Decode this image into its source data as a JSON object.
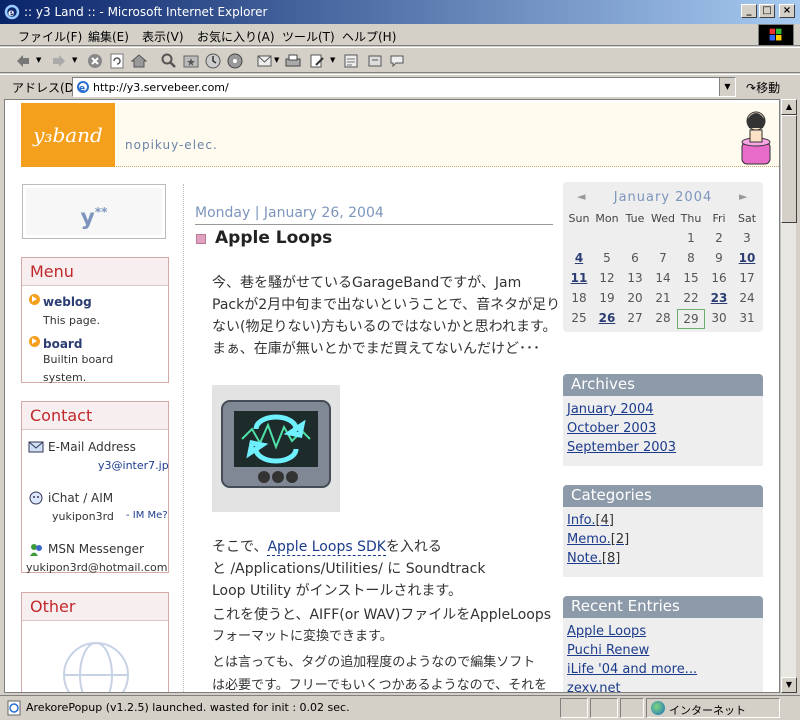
{
  "window": {
    "title": ":: y3 Land :: - Microsoft Internet Explorer",
    "controls": [
      "_",
      "□",
      "×"
    ]
  },
  "menubar": [
    "ファイル(F)",
    "編集(E)",
    "表示(V)",
    "お気に入り(A)",
    "ツール(T)",
    "ヘルプ(H)"
  ],
  "toolbar_icons": [
    "back-icon",
    "forward-icon",
    "stop-icon",
    "refresh-icon",
    "home-icon",
    "search-icon",
    "favorites-icon",
    "history-icon",
    "media-icon",
    "mail-icon",
    "print-icon",
    "edit-icon",
    "discuss-icon",
    "messenger-icon"
  ],
  "address": {
    "label": "アドレス(D)",
    "url": "http://y3.servebeer.com/",
    "go_label": "移動"
  },
  "header": {
    "logo_text": "y3 Land",
    "subtitle": "nopikuy-elec."
  },
  "ybox": "y*",
  "menu": {
    "title": "Menu",
    "items": [
      {
        "title": "weblog",
        "desc": "This page."
      },
      {
        "title": "board",
        "desc": "Builtin board system."
      }
    ]
  },
  "contact": {
    "title": "Contact",
    "items": [
      {
        "label": "E-Mail Address",
        "value": "y3@inter7.jp"
      },
      {
        "label": "iChat / AIM",
        "value": "yukipon3rd",
        "extra": "- IM Me?"
      },
      {
        "label": "MSN Messenger",
        "value": "yukipon3rd@hotmail.com"
      }
    ]
  },
  "other": {
    "title": "Other"
  },
  "entry": {
    "date": "Monday | January 26, 2004",
    "title": "Apple Loops",
    "p1": [
      "今、巷を騒がせているGarageBandですが、Jam",
      "Packが2月中旬まで出ないということで、音ネタが足り",
      "ない(物足りない)方もいるのではないかと思われます。",
      "まぁ、在庫が無いとかでまだ買えてないんだけど･･･"
    ],
    "p2_prefix": "そこで、",
    "p2_link": "Apple Loops SDK",
    "p2_suffix": "を入れる",
    "p2": [
      "と /Applications/Utilities/ に Soundtrack",
      "Loop Utility がインストールされます。",
      "これを使うと、AIFF(or WAV)ファイルをAppleLoops",
      "フォーマットに変換できます。",
      "とは言っても、タグの追加程度のようなので編集ソフト",
      "は必要です。フリーでもいくつかあるようなので、それを"
    ]
  },
  "calendar": {
    "title": "January 2004",
    "prev": "◄",
    "next": "►",
    "days": [
      "Sun",
      "Mon",
      "Tue",
      "Wed",
      "Thu",
      "Fri",
      "Sat"
    ],
    "first_weekday": 4,
    "num_days": 31,
    "links": [
      4,
      10,
      11,
      23,
      26
    ],
    "today": 29
  },
  "archives": {
    "title": "Archives",
    "items": [
      "January 2004",
      "October 2003",
      "September 2003"
    ]
  },
  "categories": {
    "title": "Categories",
    "items": [
      {
        "name": "Info.",
        "count": "[4]"
      },
      {
        "name": "Memo.",
        "count": "[2]"
      },
      {
        "name": "Note.",
        "count": "[8]"
      }
    ]
  },
  "recent": {
    "title": "Recent Entries",
    "items": [
      "Apple Loops",
      "Puchi Renew",
      "iLife '04 and more...",
      "zexy.net"
    ]
  },
  "status": {
    "text": "ArekorePopup (v1.2.5) launched. wasted for init : 0.02 sec.",
    "zone": "インターネット"
  }
}
